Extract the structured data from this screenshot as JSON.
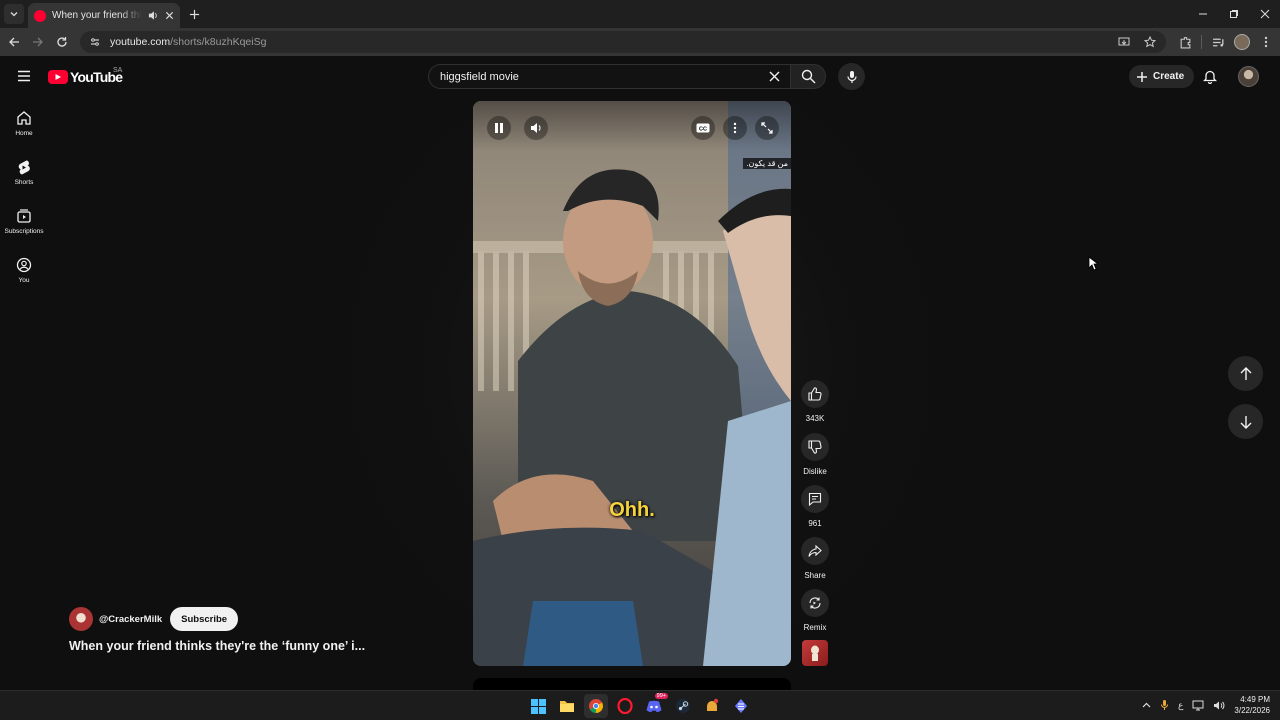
{
  "browser": {
    "tab_title": "When your friend thinks they're the 'funny one'",
    "url_host": "youtube.com",
    "url_path": "/shorts/k8uzhKqeiSg"
  },
  "youtube": {
    "logo_text": "YouTube",
    "country_code": "SA",
    "search_value": "higgsfield movie",
    "create_label": "Create"
  },
  "rail": {
    "items": [
      {
        "label": "Home",
        "icon": "home-icon"
      },
      {
        "label": "Shorts",
        "icon": "shorts-icon"
      },
      {
        "label": "Subscriptions",
        "icon": "subscriptions-icon"
      },
      {
        "label": "You",
        "icon": "you-icon"
      }
    ]
  },
  "video": {
    "caption_top": "من قد يكون.",
    "subtitle": "Ohh.",
    "state": "playing"
  },
  "actions": {
    "like_count": "343K",
    "dislike_label": "Dislike",
    "comment_count": "961",
    "share_label": "Share",
    "remix_label": "Remix"
  },
  "channel": {
    "handle": "@CrackerMilk",
    "subscribe_label": "Subscribe",
    "title": "When your friend thinks they're the ‘funny one’ i..."
  },
  "taskbar": {
    "discord_badge": "99+",
    "lang_indicator": "ع",
    "time": "4:49 PM",
    "date": "3/22/2026"
  },
  "colors": {
    "brand_red": "#ff0033",
    "subtitle_yellow": "#f5d33d",
    "bg": "#0f0f0f"
  }
}
